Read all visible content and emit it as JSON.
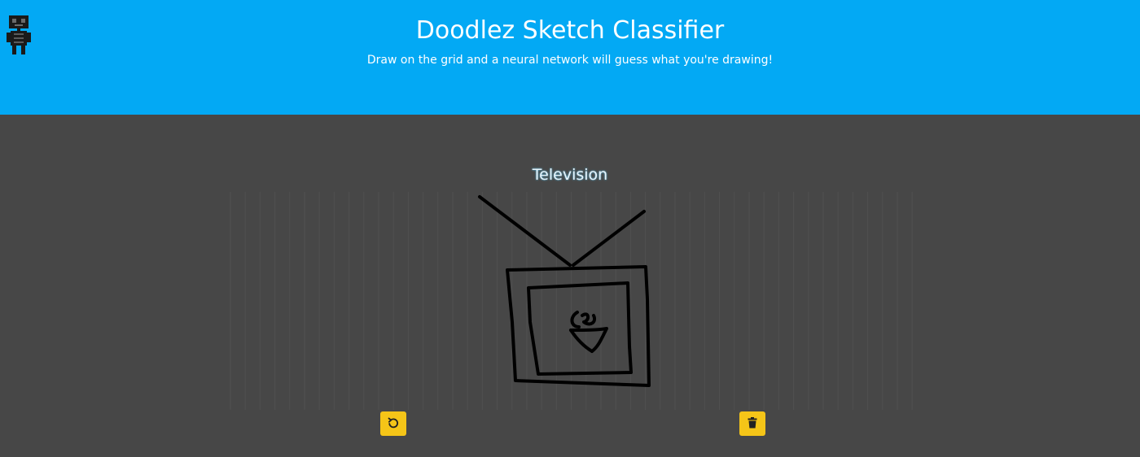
{
  "header": {
    "title": "Doodlez Sketch Classifier",
    "subtitle": "Draw on the grid and a neural network will guess what you're drawing!",
    "logo_icon": "robot-logo-icon",
    "background_color": "#03a9f4"
  },
  "main": {
    "prediction": "Television",
    "background_color": "#474747"
  },
  "toolbar": {
    "undo_icon": "undo-icon",
    "clear_icon": "trash-icon",
    "button_color": "#f5c518"
  }
}
